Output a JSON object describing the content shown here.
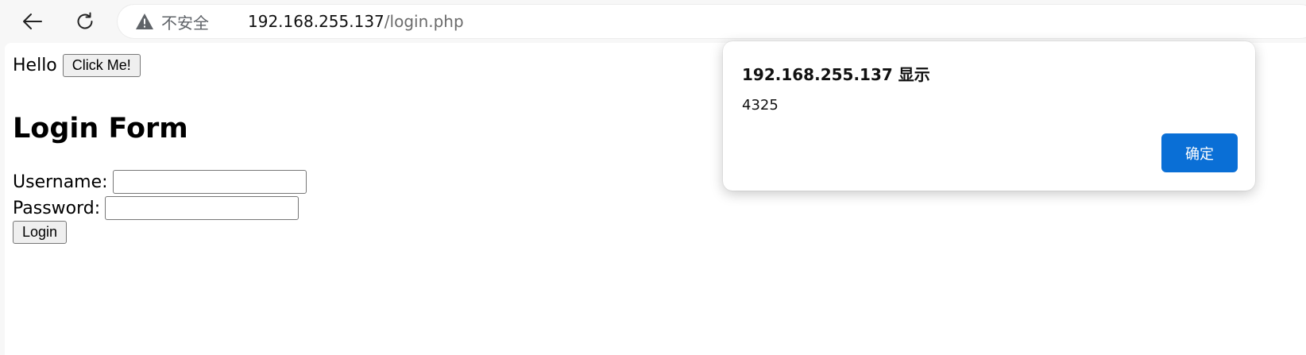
{
  "browser": {
    "back_icon": "back-arrow-icon",
    "reload_icon": "reload-icon",
    "security_icon": "warning-triangle-icon",
    "security_label": "不安全",
    "url_host": "192.168.255.137",
    "url_path": "/login.php"
  },
  "page": {
    "hello_text": "Hello",
    "click_button_label": "Click Me!",
    "title": "Login Form",
    "username_label": "Username:",
    "username_value": "",
    "password_label": "Password:",
    "password_value": "",
    "login_button_label": "Login"
  },
  "dialog": {
    "title": "192.168.255.137 显示",
    "message": "4325",
    "ok_label": "确定",
    "ok_color": "#0a6fd6"
  }
}
